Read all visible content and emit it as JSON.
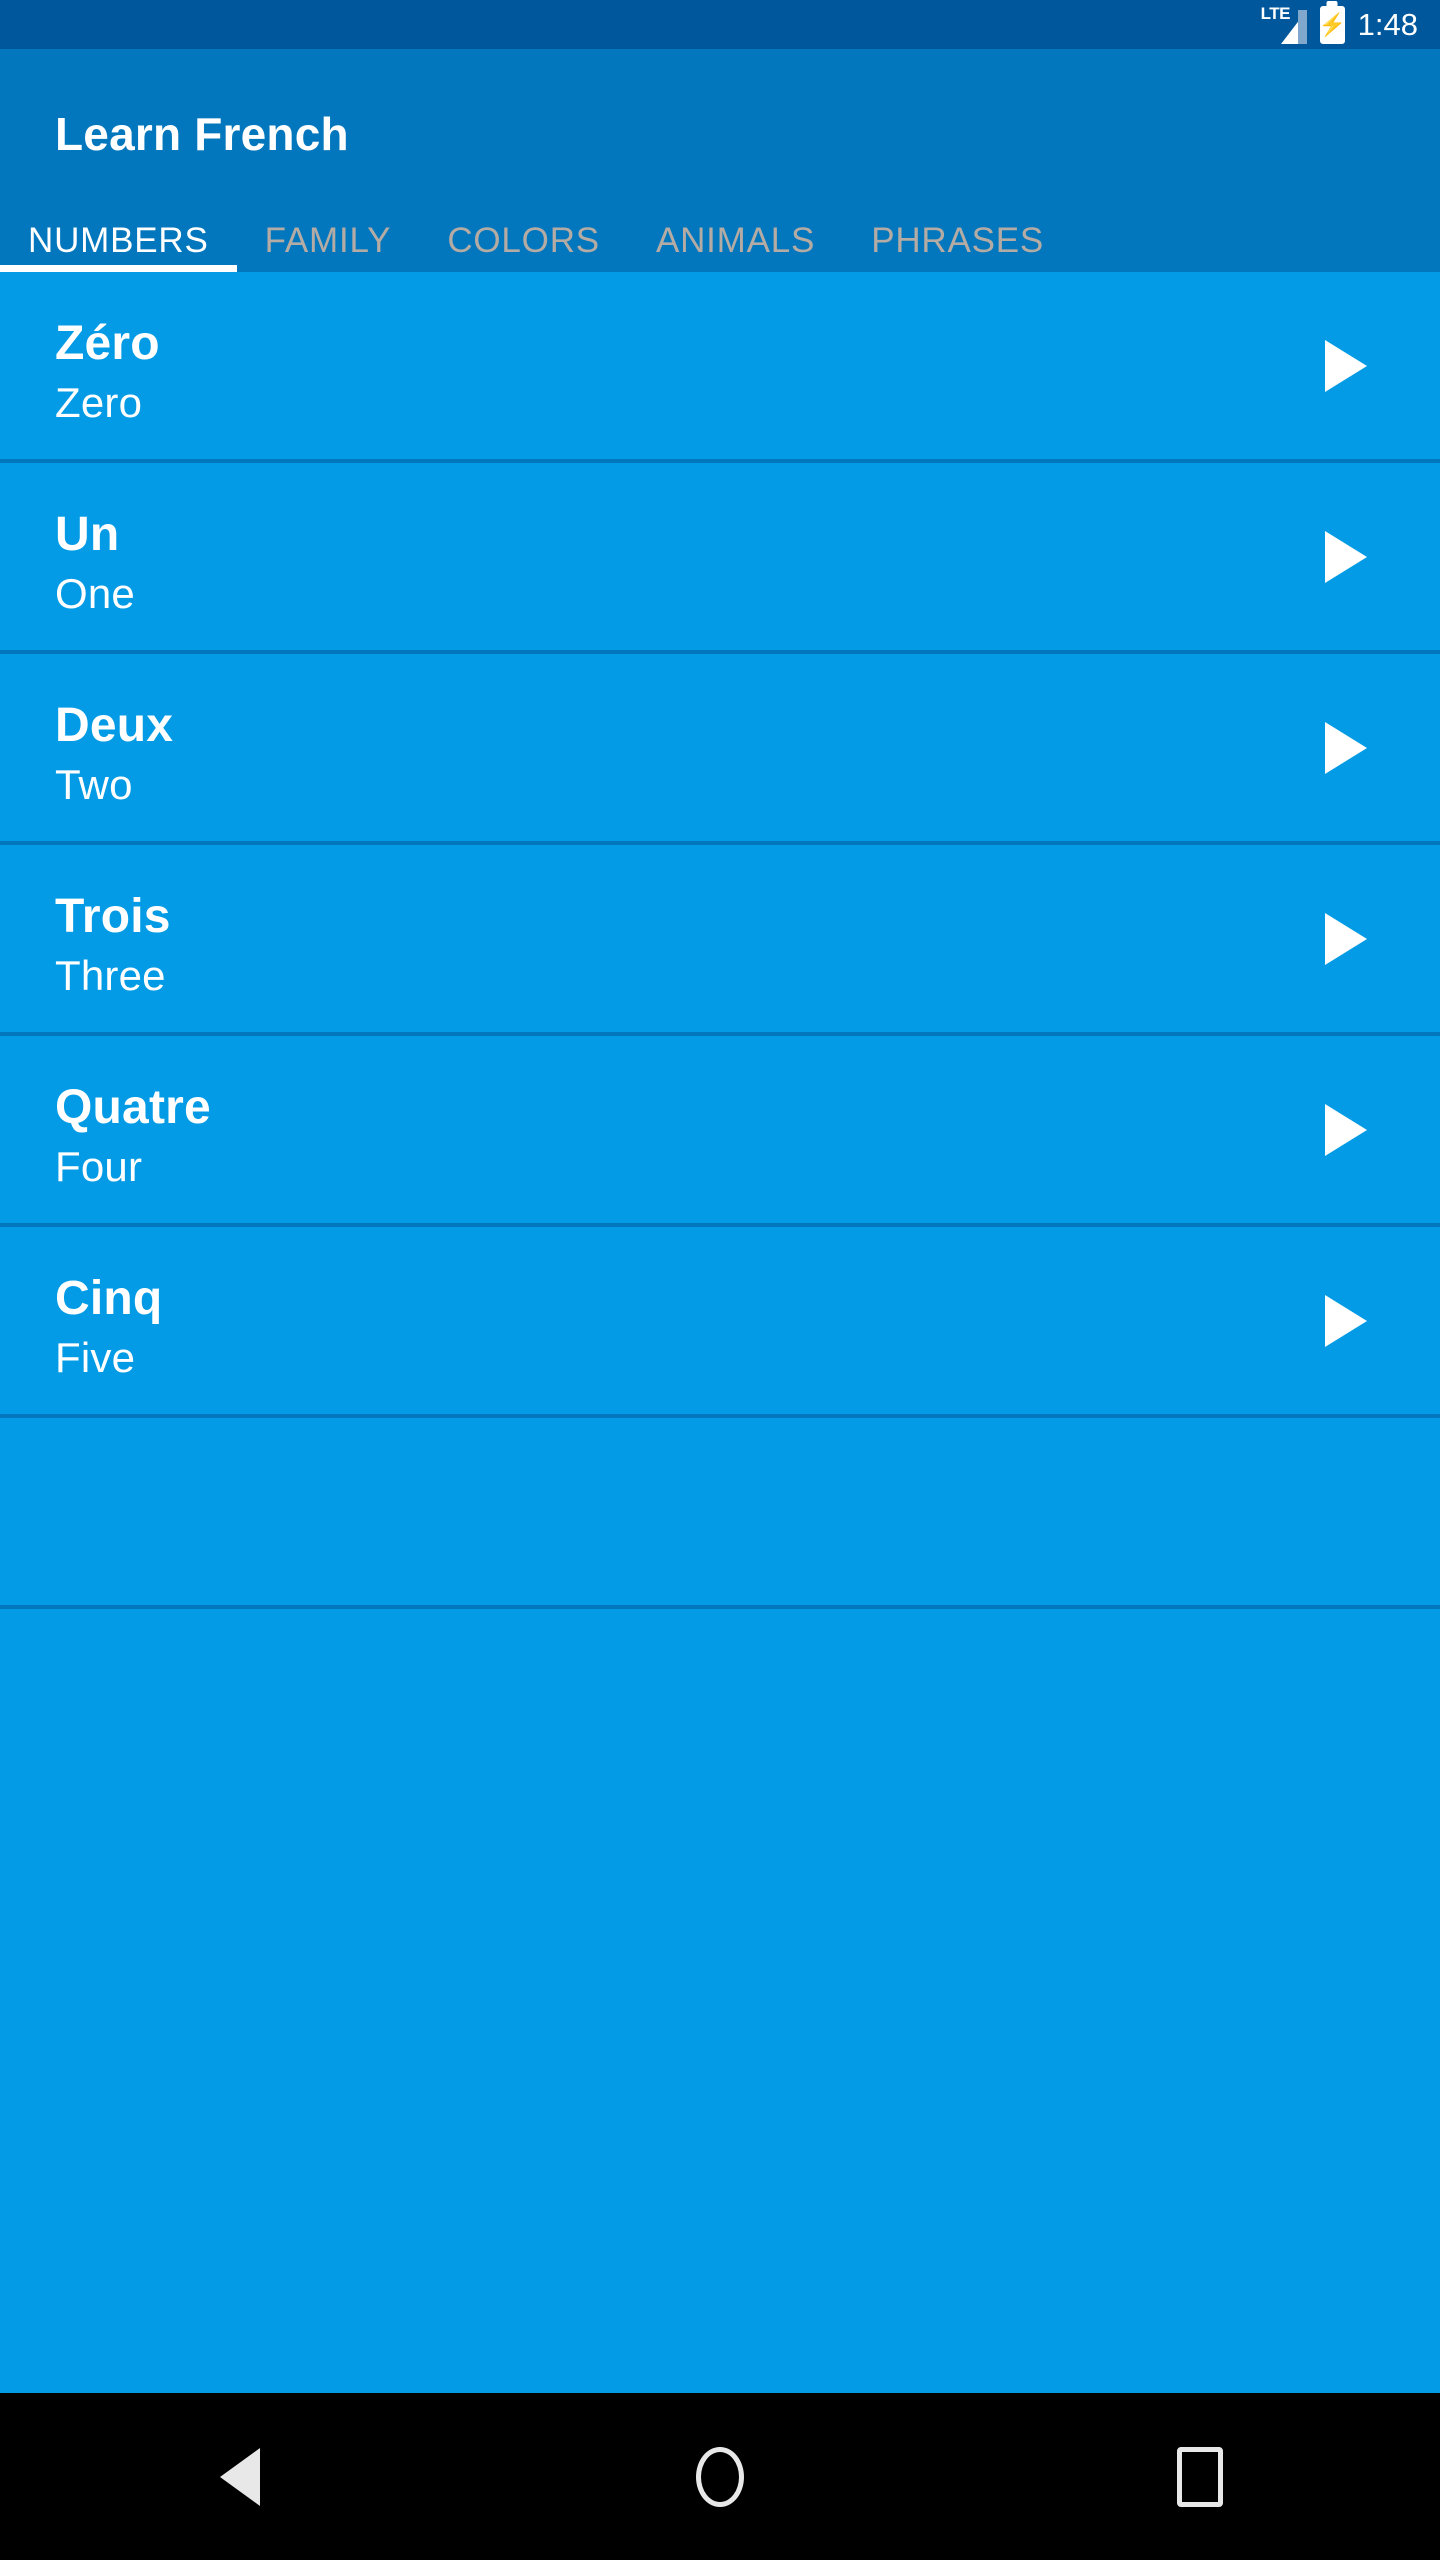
{
  "status_bar": {
    "network_label": "LTE",
    "signal_icon": "signal-bars-icon",
    "battery_icon": "battery-charging-icon",
    "charging_glyph": "⚡",
    "time": "1:48",
    "background_color": "#01579B"
  },
  "app_bar": {
    "title": "Learn French",
    "background_color": "#0277BD"
  },
  "tabs": {
    "selected_index": 0,
    "items": [
      {
        "label": "NUMBERS"
      },
      {
        "label": "FAMILY"
      },
      {
        "label": "COLORS"
      },
      {
        "label": "ANIMALS"
      },
      {
        "label": "PHRASES"
      }
    ],
    "selected_color": "#FFFFFF",
    "unselected_color": "#B4ABA4",
    "indicator_color": "#FFFFFF"
  },
  "list": {
    "background_color": "#039BE5",
    "divider_color": "#0277BD",
    "play_icon": "play-triangle-icon",
    "items": [
      {
        "french": "Zéro",
        "english": "Zero"
      },
      {
        "french": "Un",
        "english": "One"
      },
      {
        "french": "Deux",
        "english": "Two"
      },
      {
        "french": "Trois",
        "english": "Three"
      },
      {
        "french": "Quatre",
        "english": "Four"
      },
      {
        "french": "Cinq",
        "english": "Five"
      },
      {
        "french": "",
        "english": ""
      }
    ]
  },
  "nav_bar": {
    "background_color": "#000000",
    "buttons": [
      {
        "name": "back",
        "icon": "triangle-left-icon"
      },
      {
        "name": "home",
        "icon": "circle-icon"
      },
      {
        "name": "recents",
        "icon": "square-icon"
      }
    ]
  }
}
